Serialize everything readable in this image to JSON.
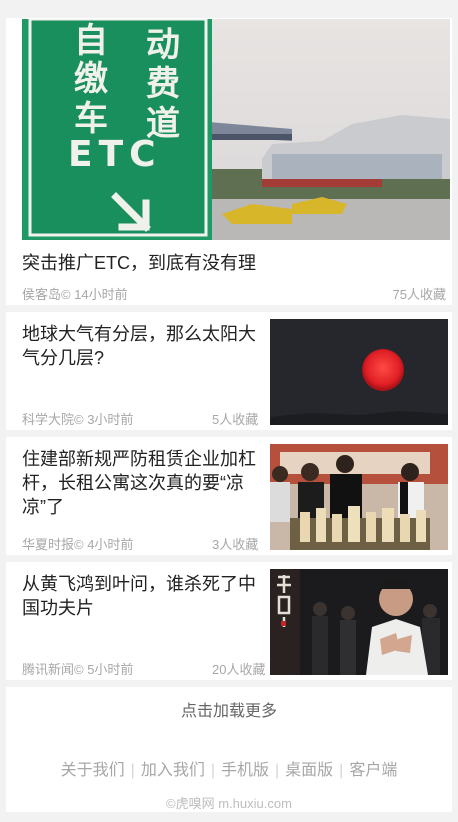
{
  "feature": {
    "title": "突击推广ETC，到底有没有理",
    "source_time": "侯客岛© 14小时前",
    "favorites": "75人收藏",
    "sign_text": [
      "自",
      "缴",
      "车",
      "ETC",
      "动",
      "费",
      "道"
    ]
  },
  "articles": [
    {
      "title": "地球大气有分层，那么太阳大气分几层?",
      "source_time": "科学大院© 3小时前",
      "favorites": "5人收藏"
    },
    {
      "title": "住建部新规严防租赁企业加杠杆，长租公寓这次真的要“凉凉”了",
      "source_time": "华夏时报© 4小时前",
      "favorites": "3人收藏"
    },
    {
      "title": "从黄飞鸿到叶问，谁杀死了中国功夫片",
      "source_time": "腾讯新闻© 5小时前",
      "favorites": "20人收藏"
    }
  ],
  "load_more": "点击加载更多",
  "footer": {
    "links": [
      "关于我们",
      "加入我们",
      "手机版",
      "桌面版",
      "客户端"
    ],
    "copyright": "©虎嗅网 m.huxiu.com"
  }
}
